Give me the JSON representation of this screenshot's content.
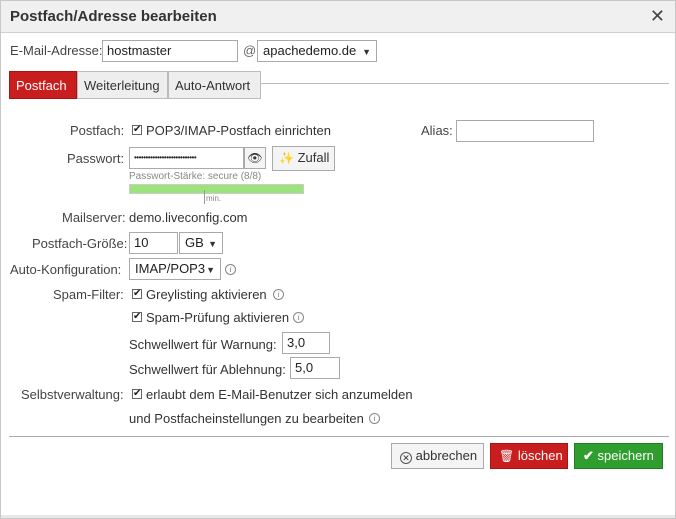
{
  "dialog": {
    "title": "Postfach/Adresse bearbeiten",
    "close_symbol": "✕"
  },
  "email": {
    "label": "E-Mail-Adresse:",
    "local_part": "hostmaster",
    "at": "@",
    "domain": "apachedemo.de"
  },
  "tabs": [
    {
      "label": "Postfach",
      "active": true
    },
    {
      "label": "Weiterleitung",
      "active": false
    },
    {
      "label": "Auto-Antwort",
      "active": false
    }
  ],
  "mailbox": {
    "label": "Postfach:",
    "checkbox_text": "POP3/IMAP-Postfach einrichten",
    "checked": true
  },
  "alias": {
    "label": "Alias:",
    "value": ""
  },
  "password": {
    "label": "Passwort:",
    "masked_value": "•••••••••••••••••••••••••••",
    "random_button": "Zufall",
    "strength_text": "Passwort-Stärke: secure (8/8)",
    "strength_fraction": 1.0,
    "min_label": "min."
  },
  "mailserver": {
    "label": "Mailserver:",
    "value": "demo.liveconfig.com"
  },
  "mailbox_size": {
    "label": "Postfach-Größe:",
    "value": "10",
    "unit": "GB"
  },
  "autoconfig": {
    "label": "Auto-Konfiguration:",
    "value": "IMAP/POP3"
  },
  "spam": {
    "label": "Spam-Filter:",
    "greylisting": "Greylisting aktivieren",
    "spamcheck": "Spam-Prüfung aktivieren",
    "warn_label": "Schwellwert für Warnung:",
    "warn_value": "3,0",
    "reject_label": "Schwellwert für Ablehnung:",
    "reject_value": "5,0"
  },
  "selfservice": {
    "label": "Selbstverwaltung:",
    "line1": "erlaubt dem E-Mail-Benutzer sich anzumelden",
    "line2": "und Postfacheinstellungen zu bearbeiten"
  },
  "buttons": {
    "cancel": "abbrechen",
    "delete": "löschen",
    "save": "speichern"
  },
  "colors": {
    "accent_red": "#c81e1e",
    "save_green": "#2f9e2f",
    "strength_green": "#9be37a"
  }
}
